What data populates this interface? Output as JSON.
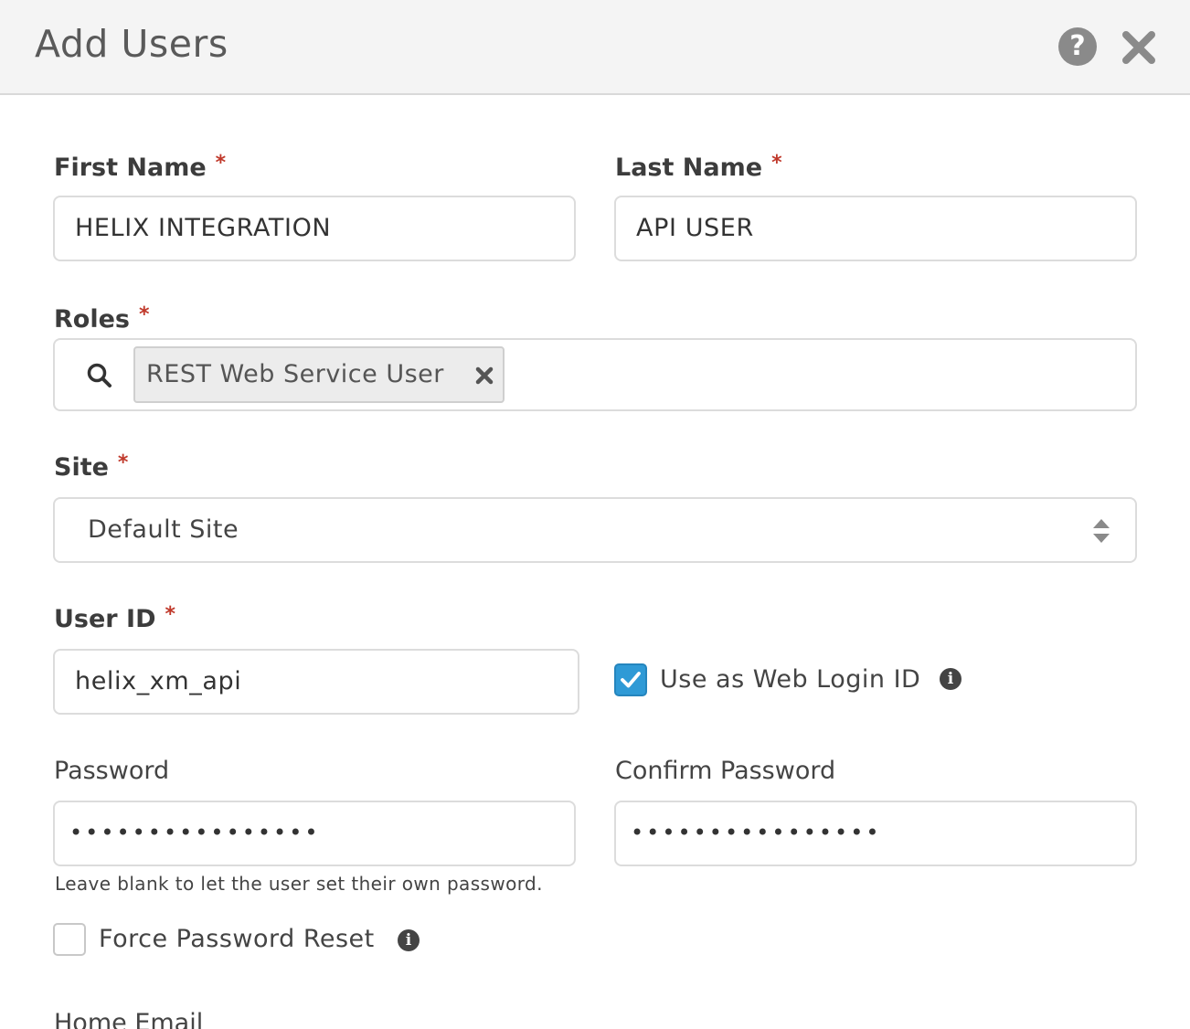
{
  "dialog": {
    "title": "Add Users",
    "help_icon": "question-circle-icon",
    "help_symbol": "?",
    "close_icon": "close-icon"
  },
  "form": {
    "required_marker": "*",
    "first_name": {
      "label": "First Name",
      "value": "HELIX INTEGRATION"
    },
    "last_name": {
      "label": "Last Name",
      "value": "API USER"
    },
    "roles": {
      "label": "Roles",
      "search_icon": "search-icon",
      "selected": [
        {
          "label": "REST Web Service User",
          "remove_icon": "close-icon"
        }
      ]
    },
    "site": {
      "label": "Site",
      "value": "Default Site",
      "icon": "sort-arrows-icon"
    },
    "user_id": {
      "label": "User ID",
      "value": "helix_xm_api"
    },
    "use_as_web_login": {
      "label": "Use as Web Login ID",
      "checked": true,
      "info_icon": "info-circle-icon"
    },
    "password": {
      "label": "Password",
      "value": "••••••••••••••••",
      "hint": "Leave blank to let the user set their own password."
    },
    "confirm_password": {
      "label": "Confirm Password",
      "value": "••••••••••••••••"
    },
    "force_password_reset": {
      "label": "Force Password Reset",
      "checked": false,
      "info_icon": "info-circle-icon"
    },
    "home_email": {
      "label": "Home Email"
    },
    "info_symbol": "i"
  },
  "colors": {
    "accent": "#2f9ad6",
    "required": "#c0392b",
    "header_bg": "#f4f4f4",
    "border": "#dcdcdc"
  }
}
